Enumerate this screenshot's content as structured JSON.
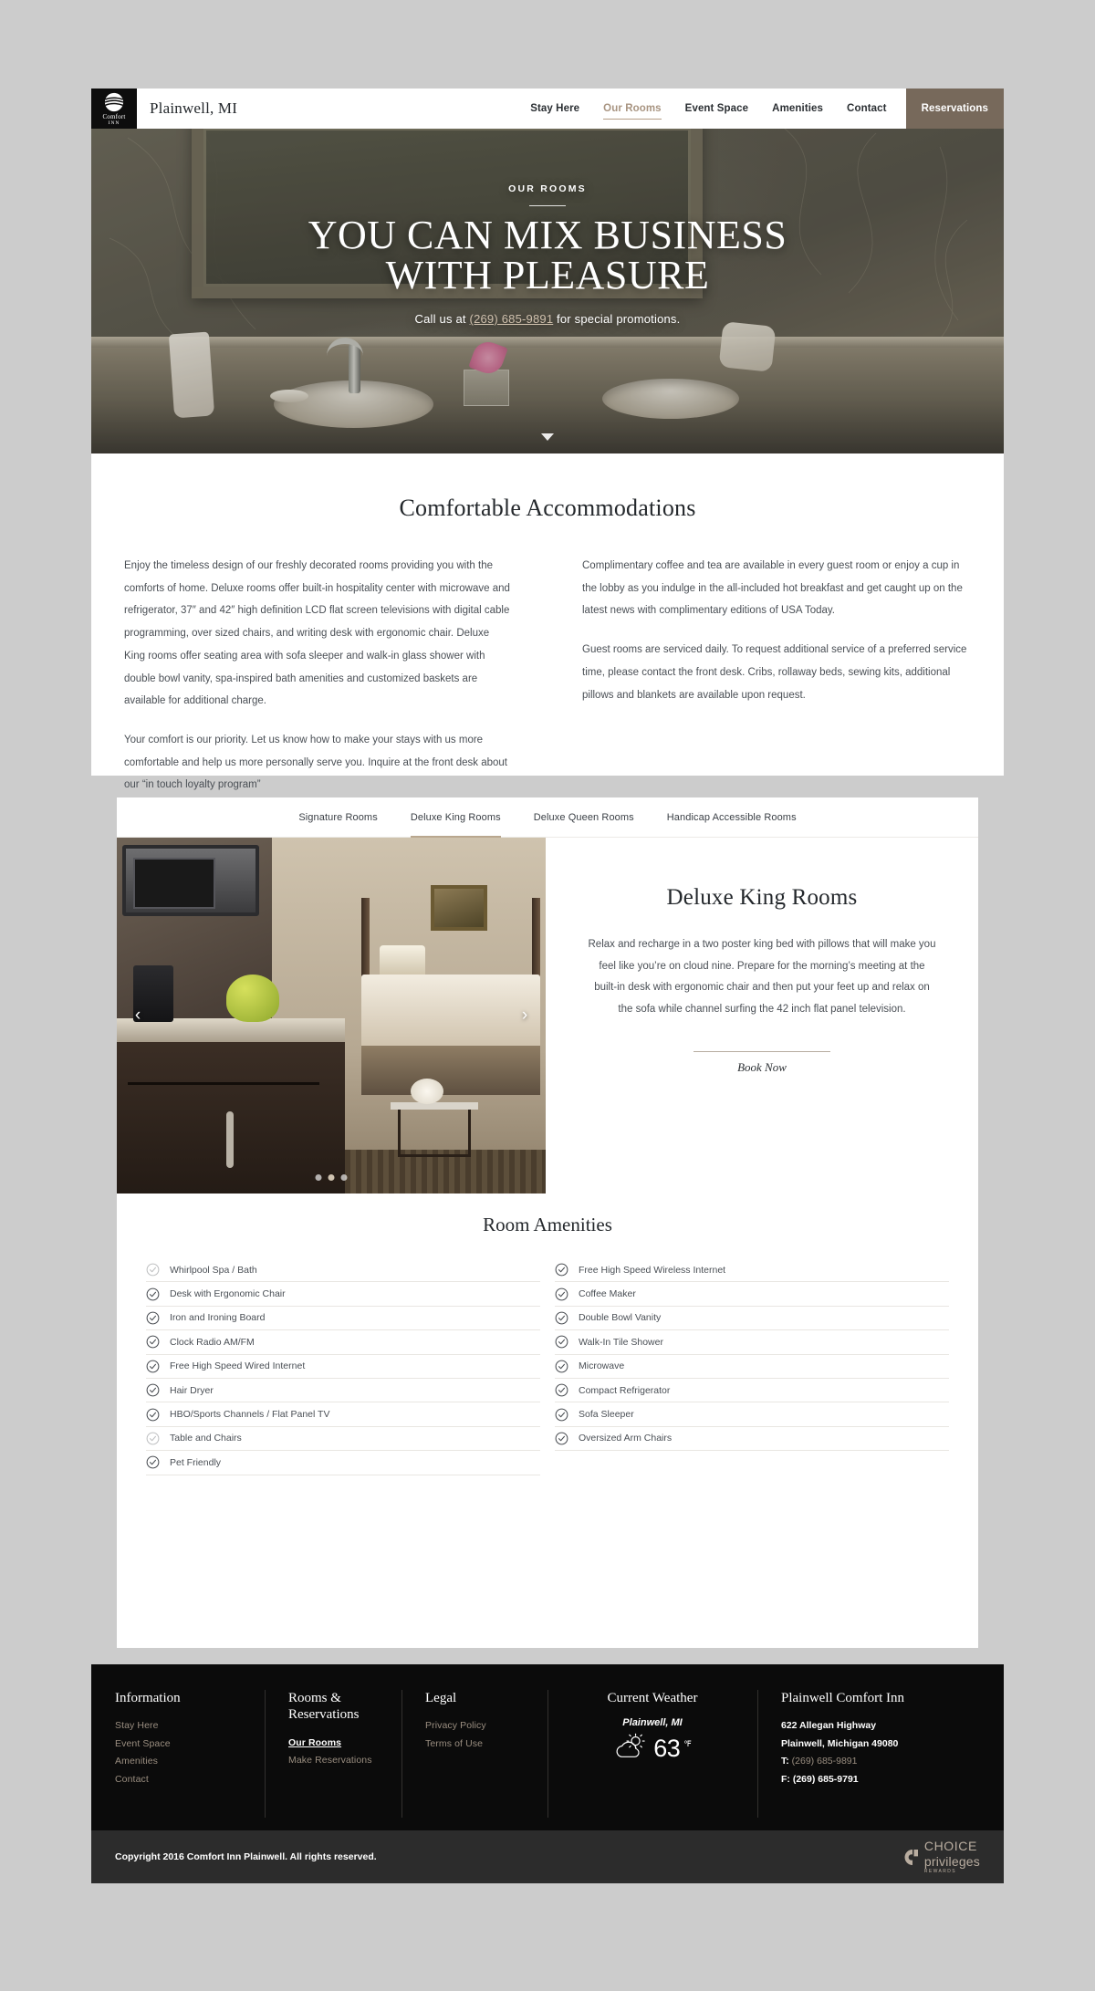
{
  "header": {
    "logo": {
      "brand": "Comfort",
      "sub": "INN",
      "icon": "comfort-inn-swoosh-icon"
    },
    "city": "Plainwell, MI",
    "nav": [
      {
        "label": "Stay Here",
        "active": false
      },
      {
        "label": "Our Rooms",
        "active": true
      },
      {
        "label": "Event Space",
        "active": false
      },
      {
        "label": "Amenities",
        "active": false
      },
      {
        "label": "Contact",
        "active": false
      }
    ],
    "reservations_label": "Reservations",
    "accent_color": "#b49d86",
    "reservations_bg": "#77695b"
  },
  "hero": {
    "eyebrow": "OUR ROOMS",
    "title_line1": "YOU CAN MIX BUSINESS",
    "title_line2": "WITH PLEASURE",
    "sub_before": "Call us at ",
    "sub_phone": "(269) 685-9891",
    "sub_after": " for special promotions.",
    "scroll_icon": "chevron-down-icon"
  },
  "intro": {
    "heading": "Comfortable Accommodations",
    "left_paragraphs": [
      "Enjoy the timeless design of our freshly decorated rooms providing you with the comforts of home. Deluxe rooms offer built-in hospitality center with microwave and refrigerator, 37″ and 42″ high definition LCD flat screen televisions with digital cable programming, over sized chairs, and writing desk with ergonomic chair. Deluxe King rooms offer seating area with sofa sleeper and walk-in glass shower with double bowl vanity, spa-inspired bath amenities and customized baskets are available for additional charge.",
      "Your comfort is our priority. Let us know how to make your stays with us more comfortable and help us more personally serve you. Inquire at the front desk about our “in touch loyalty program”"
    ],
    "right_paragraphs": [
      "Complimentary coffee and tea are available in every guest room or enjoy a cup in the lobby as you indulge in the all-included hot breakfast and get caught up on the latest news with complimentary editions of USA Today.",
      "Guest rooms are serviced daily. To request additional service of a preferred service time, please contact the front desk. Cribs, rollaway beds, sewing kits, additional pillows and blankets are available upon request."
    ]
  },
  "rooms": {
    "tabs": [
      {
        "label": "Signature Rooms",
        "active": false
      },
      {
        "label": "Deluxe King Rooms",
        "active": true
      },
      {
        "label": "Deluxe Queen Rooms",
        "active": false
      },
      {
        "label": "Handicap Accessible Rooms",
        "active": false
      }
    ],
    "gallery": {
      "prev_icon": "chevron-left-icon",
      "prev_glyph": "‹",
      "next_icon": "chevron-right-icon",
      "next_glyph": "›",
      "dots": 3,
      "active_dot": 2
    },
    "title": "Deluxe King Rooms",
    "description": "Relax and recharge in a two poster king bed with pillows that will make you feel like you’re on cloud nine. Prepare for the morning’s meeting at the built-in desk with ergonomic chair and then put your feet up and relax on the sofa while channel surfing the 42 inch flat panel television.",
    "book_now_label": "Book Now"
  },
  "amenities": {
    "heading": "Room Amenities",
    "left": [
      {
        "label": "Whirlpool Spa / Bath",
        "dim": true
      },
      {
        "label": "Desk with Ergonomic Chair",
        "dim": false
      },
      {
        "label": "Iron and Ironing Board",
        "dim": false
      },
      {
        "label": "Clock Radio AM/FM",
        "dim": false
      },
      {
        "label": "Free High Speed Wired Internet",
        "dim": false
      },
      {
        "label": "Hair Dryer",
        "dim": false
      },
      {
        "label": "HBO/Sports Channels / Flat Panel TV",
        "dim": false
      },
      {
        "label": "Table and Chairs",
        "dim": true
      },
      {
        "label": "Pet Friendly",
        "dim": false
      }
    ],
    "right": [
      {
        "label": "Free High Speed Wireless Internet",
        "dim": false
      },
      {
        "label": "Coffee Maker",
        "dim": false
      },
      {
        "label": "Double Bowl Vanity",
        "dim": false
      },
      {
        "label": "Walk-In Tile Shower",
        "dim": false
      },
      {
        "label": "Microwave",
        "dim": false
      },
      {
        "label": "Compact Refrigerator",
        "dim": false
      },
      {
        "label": "Sofa Sleeper",
        "dim": false
      },
      {
        "label": "Oversized Arm Chairs",
        "dim": false
      }
    ]
  },
  "footer": {
    "information": {
      "heading": "Information",
      "links": [
        "Stay Here",
        "Event Space",
        "Amenities",
        "Contact"
      ]
    },
    "rooms_reservations": {
      "heading": "Rooms & Reservations",
      "links": [
        {
          "label": "Our Rooms",
          "current": true
        },
        {
          "label": "Make Reservations",
          "current": false
        }
      ]
    },
    "legal": {
      "heading": "Legal",
      "links": [
        "Privacy Policy",
        "Terms of Use"
      ]
    },
    "weather": {
      "heading": "Current Weather",
      "city": "Plainwell, MI",
      "icon": "partly-cloudy-icon",
      "temperature": "63",
      "unit": "℉"
    },
    "property": {
      "heading": "Plainwell Comfort Inn",
      "address1": "622 Allegan Highway",
      "address2": "Plainwell, Michigan 49080",
      "phone_label": "T:",
      "phone": "(269) 685-9891",
      "fax_label": "F:",
      "fax": "(269) 685-9791"
    }
  },
  "copyright": {
    "text": "Copyright 2016 Comfort Inn Plainwell. All rights reserved.",
    "choice": {
      "line1": "CHOICE",
      "line2": "privileges",
      "line3": "REWARDS",
      "icon": "choice-privileges-logo-icon"
    }
  }
}
